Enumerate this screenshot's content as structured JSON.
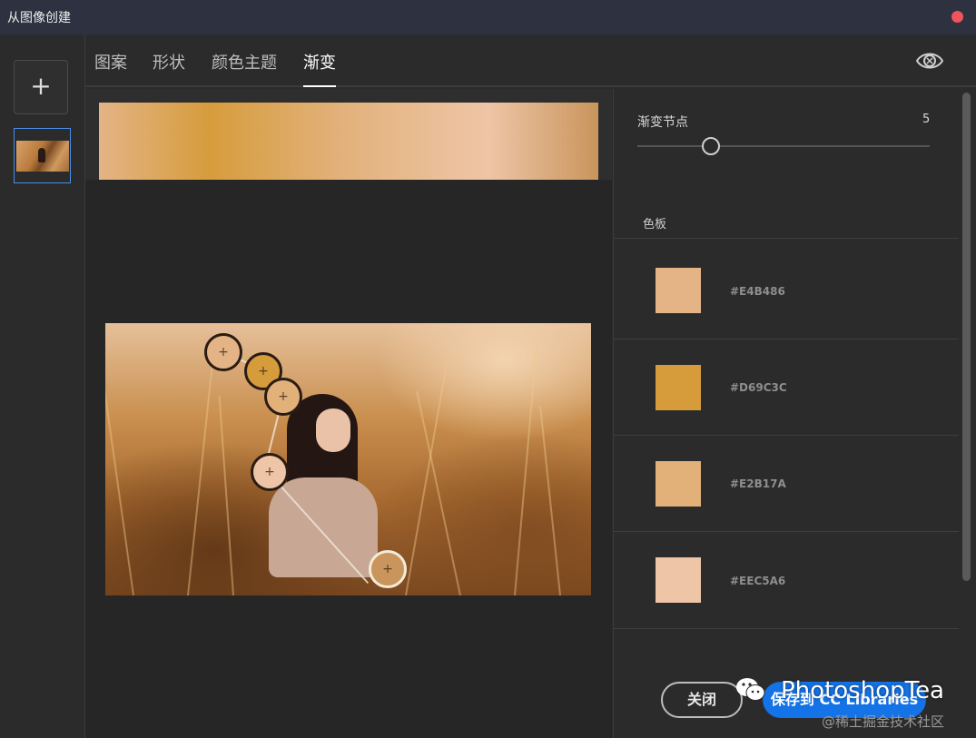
{
  "window": {
    "title": "从图像创建"
  },
  "sidebar": {
    "add_label": "+"
  },
  "tabs": [
    {
      "label": "图案"
    },
    {
      "label": "形状"
    },
    {
      "label": "颜色主题"
    },
    {
      "label": "渐变",
      "active": true
    }
  ],
  "panel": {
    "stops_label": "渐变节点",
    "stops_value": "5",
    "slider_fraction": 0.25,
    "swatches_heading": "色板",
    "swatches": [
      {
        "hex": "#E4B486",
        "color": "#E4B486"
      },
      {
        "hex": "#D69C3C",
        "color": "#D69C3C"
      },
      {
        "hex": "#E2B17A",
        "color": "#E2B17A"
      },
      {
        "hex": "#EEC5A6",
        "color": "#EEC5A6"
      }
    ]
  },
  "buttons": {
    "close_label": "关闭",
    "save_label": "保存到 CC Libraries"
  },
  "watermark": {
    "text": "PhotoshopTea",
    "sub": "@稀土掘金技术社区"
  },
  "colors": {
    "accent": "#1473E6",
    "titlebar": "#2E3240",
    "close_dot": "#F0545A"
  }
}
